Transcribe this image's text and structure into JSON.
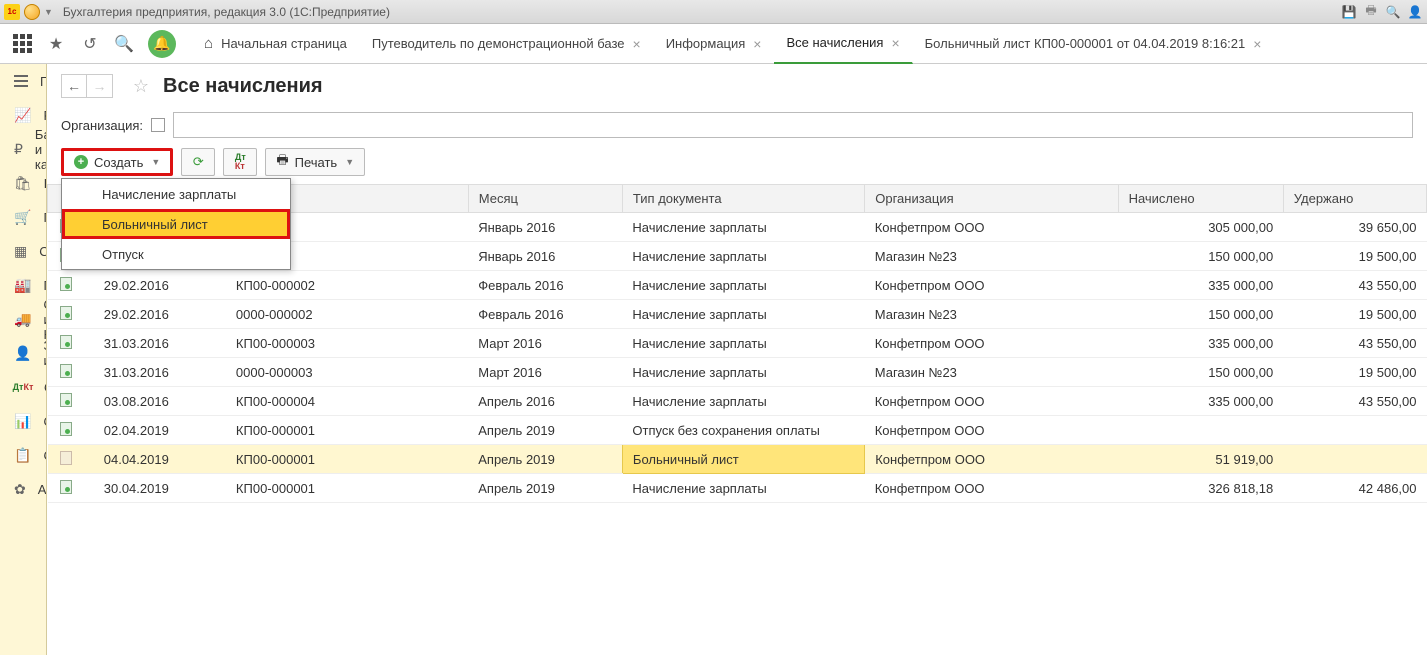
{
  "window_title": "Бухгалтерия предприятия, редакция 3.0  (1С:Предприятие)",
  "tabs": {
    "home": "Начальная страница",
    "items": [
      {
        "label": "Путеводитель по демонстрационной базе"
      },
      {
        "label": "Информация"
      },
      {
        "label": "Все начисления",
        "active": true
      },
      {
        "label": "Больничный лист КП00-000001 от 04.04.2019 8:16:21"
      }
    ]
  },
  "sidebar": [
    {
      "label": "Главное",
      "icon": "hamburger"
    },
    {
      "label": "Руководителю",
      "icon": "chart"
    },
    {
      "label": "Банк и касса",
      "icon": "ruble"
    },
    {
      "label": "Продажи",
      "icon": "bag"
    },
    {
      "label": "Покупки",
      "icon": "cart"
    },
    {
      "label": "Склад",
      "icon": "warehouse"
    },
    {
      "label": "Производство",
      "icon": "factory"
    },
    {
      "label": "ОС и НМА",
      "icon": "truck"
    },
    {
      "label": "Зарплата и кадры",
      "icon": "person"
    },
    {
      "label": "Операции",
      "icon": "dtkt"
    },
    {
      "label": "Отчеты",
      "icon": "bars"
    },
    {
      "label": "Справочники",
      "icon": "book"
    },
    {
      "label": "Администрирование",
      "icon": "gear"
    }
  ],
  "page": {
    "title": "Все начисления",
    "filter_label": "Организация:",
    "filter_value": "",
    "create_btn": "Создать",
    "print_btn": "Печать",
    "dropdown": [
      {
        "label": "Начисление зарплаты"
      },
      {
        "label": "Больничный лист",
        "highlighted": true
      },
      {
        "label": "Отпуск"
      }
    ],
    "columns": [
      "Дата",
      "Номер",
      "Месяц",
      "Тип документа",
      "Организация",
      "Начислено",
      "Удержано"
    ],
    "rows": [
      {
        "posted": true,
        "date": "",
        "number": "",
        "month": "Январь 2016",
        "type": "Начисление зарплаты",
        "org": "Конфетпром ООО",
        "accr": "305 000,00",
        "ded": "39 650,00"
      },
      {
        "posted": true,
        "date": "",
        "number": "",
        "month": "Январь 2016",
        "type": "Начисление зарплаты",
        "org": "Магазин №23",
        "accr": "150 000,00",
        "ded": "19 500,00"
      },
      {
        "posted": true,
        "date": "29.02.2016",
        "number": "КП00-000002",
        "month": "Февраль 2016",
        "type": "Начисление зарплаты",
        "org": "Конфетпром ООО",
        "accr": "335 000,00",
        "ded": "43 550,00"
      },
      {
        "posted": true,
        "date": "29.02.2016",
        "number": "0000-000002",
        "month": "Февраль 2016",
        "type": "Начисление зарплаты",
        "org": "Магазин №23",
        "accr": "150 000,00",
        "ded": "19 500,00"
      },
      {
        "posted": true,
        "date": "31.03.2016",
        "number": "КП00-000003",
        "month": "Март 2016",
        "type": "Начисление зарплаты",
        "org": "Конфетпром ООО",
        "accr": "335 000,00",
        "ded": "43 550,00"
      },
      {
        "posted": true,
        "date": "31.03.2016",
        "number": "0000-000003",
        "month": "Март 2016",
        "type": "Начисление зарплаты",
        "org": "Магазин №23",
        "accr": "150 000,00",
        "ded": "19 500,00"
      },
      {
        "posted": true,
        "date": "03.08.2016",
        "number": "КП00-000004",
        "month": "Апрель 2016",
        "type": "Начисление зарплаты",
        "org": "Конфетпром ООО",
        "accr": "335 000,00",
        "ded": "43 550,00"
      },
      {
        "posted": true,
        "date": "02.04.2019",
        "number": "КП00-000001",
        "month": "Апрель 2019",
        "type": "Отпуск без сохранения оплаты",
        "org": "Конфетпром ООО",
        "accr": "",
        "ded": ""
      },
      {
        "posted": false,
        "selected": true,
        "date": "04.04.2019",
        "number": "КП00-000001",
        "month": "Апрель 2019",
        "type": "Больничный лист",
        "org": "Конфетпром ООО",
        "accr": "51 919,00",
        "ded": ""
      },
      {
        "posted": true,
        "date": "30.04.2019",
        "number": "КП00-000001",
        "month": "Апрель 2019",
        "type": "Начисление зарплаты",
        "org": "Конфетпром ООО",
        "accr": "326 818,18",
        "ded": "42 486,00"
      }
    ]
  }
}
